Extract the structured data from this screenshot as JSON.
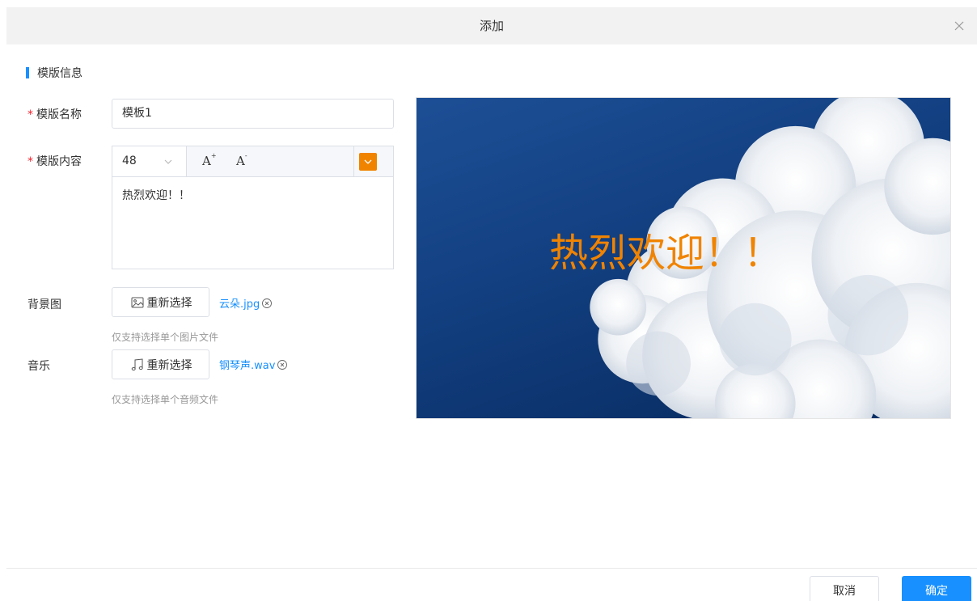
{
  "dialog": {
    "title": "添加"
  },
  "section": {
    "title": "模版信息"
  },
  "form": {
    "required_mark": "*",
    "name": {
      "label": "模版名称",
      "value": "模板1"
    },
    "content": {
      "label": "模版内容",
      "font_size": "48",
      "font_increase": "A",
      "font_decrease": "A",
      "text_color": "#f08300",
      "text": "热烈欢迎！！"
    },
    "background": {
      "label": "背景图",
      "button_label": "重新选择",
      "file_name": "云朵.jpg",
      "hint": "仅支持选择单个图片文件",
      "icon": "image-icon"
    },
    "music": {
      "label": "音乐",
      "button_label": "重新选择",
      "file_name": "钢琴声.wav",
      "hint": "仅支持选择单个音频文件",
      "icon": "music-note-icon"
    }
  },
  "preview": {
    "text": "热烈欢迎！！",
    "text_color": "#f08300"
  },
  "footer": {
    "cancel_label": "取消",
    "ok_label": "确定"
  },
  "colors": {
    "accent": "#1890ff",
    "required": "#f5222d",
    "hint": "#999999"
  }
}
